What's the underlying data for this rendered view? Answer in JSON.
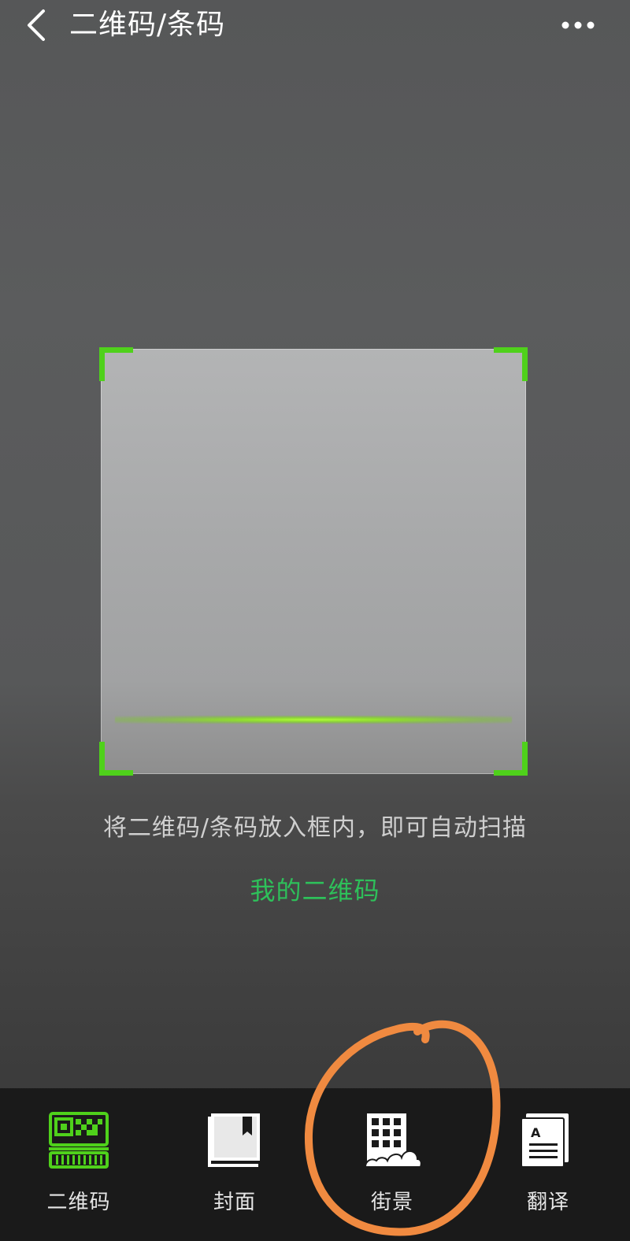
{
  "header": {
    "title": "二维码/条码",
    "back_icon": "chevron-left-icon",
    "more_icon": "more-dots-icon"
  },
  "scanner": {
    "hint": "将二维码/条码放入框内，即可自动扫描",
    "my_qr_link": "我的二维码",
    "accent_color": "#4fd11b",
    "link_color": "#2ec05a"
  },
  "tabs": [
    {
      "label": "二维码",
      "icon": "qr-barcode-icon",
      "active": true
    },
    {
      "label": "封面",
      "icon": "book-cover-icon",
      "active": false
    },
    {
      "label": "街景",
      "icon": "street-building-icon",
      "active": false
    },
    {
      "label": "翻译",
      "icon": "translate-document-icon",
      "active": false
    }
  ],
  "annotation": {
    "color": "#f08a40"
  }
}
